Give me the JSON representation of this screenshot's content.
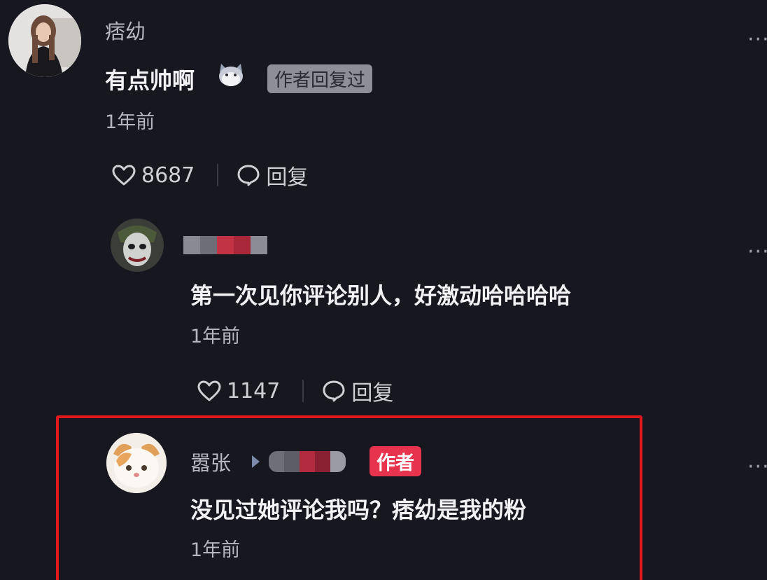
{
  "comments": [
    {
      "username": "痞幼",
      "content": "有点帅啊",
      "badge": "作者回复过",
      "time": "1年前",
      "likes": "8687",
      "reply_label": "回复",
      "avatar_icon": "woman-photo-avatar",
      "emoji_icon": "cat-emoji-icon"
    },
    {
      "username": "",
      "content": "第一次见你评论别人，好激动哈哈哈哈",
      "time": "1年前",
      "likes": "1147",
      "reply_label": "回复",
      "avatar_icon": "joker-photo-avatar"
    },
    {
      "username": "嚣张",
      "badge": "作者",
      "content": "没见过她评论我吗？痞幼是我的粉",
      "time": "1年前",
      "avatar_icon": "cat-photo-avatar"
    }
  ],
  "more_label": "···",
  "colors": {
    "background": "#17171f",
    "author_badge": "#e8334f",
    "highlight_border": "#e0191d"
  }
}
